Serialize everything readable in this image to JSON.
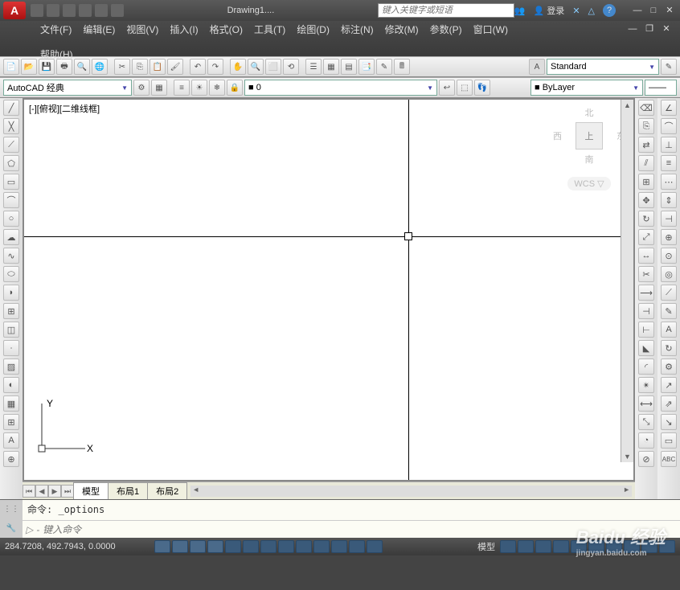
{
  "app": {
    "logo_letter": "A",
    "doc_title": "Drawing1....",
    "search_placeholder": "键入关键字或短语",
    "login_text": "登录"
  },
  "menus": [
    "文件(F)",
    "编辑(E)",
    "视图(V)",
    "插入(I)",
    "格式(O)",
    "工具(T)",
    "绘图(D)",
    "标注(N)",
    "修改(M)",
    "参数(P)",
    "窗口(W)",
    "帮助(H)"
  ],
  "toolbar2": {
    "workspace": "AutoCAD 经典",
    "layer_color": "■ 0",
    "text_style": "Standard",
    "bylayer": "ByLayer"
  },
  "canvas": {
    "view_label": "[-][俯视][二维线框]",
    "viewcube": {
      "n": "北",
      "s": "南",
      "e": "东",
      "w": "西",
      "top": "上",
      "wcs": "WCS ▽"
    },
    "ucs": {
      "x": "X",
      "y": "Y"
    }
  },
  "tabs": {
    "nav": [
      "⏮",
      "◀",
      "▶",
      "⏭"
    ],
    "items": [
      "模型",
      "布局1",
      "布局2"
    ]
  },
  "cmd": {
    "history": "命令: _options",
    "prompt_icon": "▷",
    "prompt_placeholder": "键入命令"
  },
  "status": {
    "coords": "284.7208, 492.7943, 0.0000",
    "model_btn": "模型"
  },
  "watermark": {
    "brand": "Baidu 经验",
    "url": "jingyan.baidu.com"
  }
}
